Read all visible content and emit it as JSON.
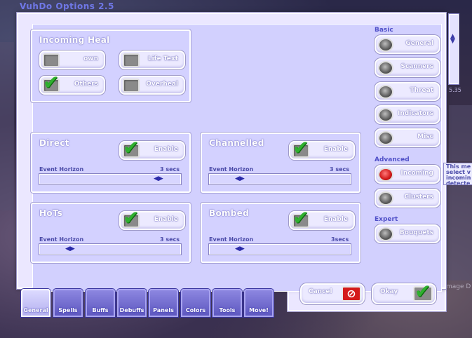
{
  "window": {
    "title": "VuhDo Options 2.5"
  },
  "incoming_heal": {
    "title": "Incoming Heal",
    "toggles": [
      {
        "label": "own",
        "checked": false
      },
      {
        "label": "Life Text",
        "checked": false
      },
      {
        "label": "Others",
        "checked": true
      },
      {
        "label": "Overheal",
        "checked": false
      }
    ]
  },
  "direct": {
    "title": "Direct",
    "enable_label": "Enable",
    "enabled": true,
    "slider_label": "Event Horizon",
    "slider_value": "3 secs",
    "slider_fraction": 0.9
  },
  "channelled": {
    "title": "Channelled",
    "enable_label": "Enable",
    "enabled": true,
    "slider_label": "Event Horizon",
    "slider_value": "3 secs",
    "slider_fraction": 0.2
  },
  "hots": {
    "title": "HoTs",
    "enable_label": "Enable",
    "enabled": true,
    "slider_label": "Event Horizon",
    "slider_value": "3 secs",
    "slider_fraction": 0.2
  },
  "bombed": {
    "title": "Bombed",
    "enable_label": "Enable",
    "enabled": true,
    "slider_label": "Event Horizon",
    "slider_value": "3secs",
    "slider_fraction": 0.2
  },
  "nav": {
    "basic_header": "Basic",
    "advanced_header": "Advanced",
    "expert_header": "Expert",
    "basic": [
      "General",
      "Scanners",
      "Threat",
      "Indicators",
      "Misc"
    ],
    "advanced": [
      "Incoming",
      "Clusters"
    ],
    "expert": [
      "Bouquets"
    ],
    "selected": "Incoming"
  },
  "tooltip": {
    "lines": [
      "This me",
      "select v",
      "incomin",
      "detecte"
    ]
  },
  "tabs": [
    "General",
    "Spells",
    "Buffs",
    "Debuffs",
    "Panels",
    "Colors",
    "Tools",
    "Move!"
  ],
  "active_tab": "General",
  "actions": {
    "cancel": "Cancel",
    "okay": "Okay"
  },
  "background": {
    "behind_text": "mage D",
    "level_text": "5.35"
  },
  "colors": {
    "accent": "#d01818",
    "check": "#2fb02f",
    "panel": "#d3d1ff"
  }
}
